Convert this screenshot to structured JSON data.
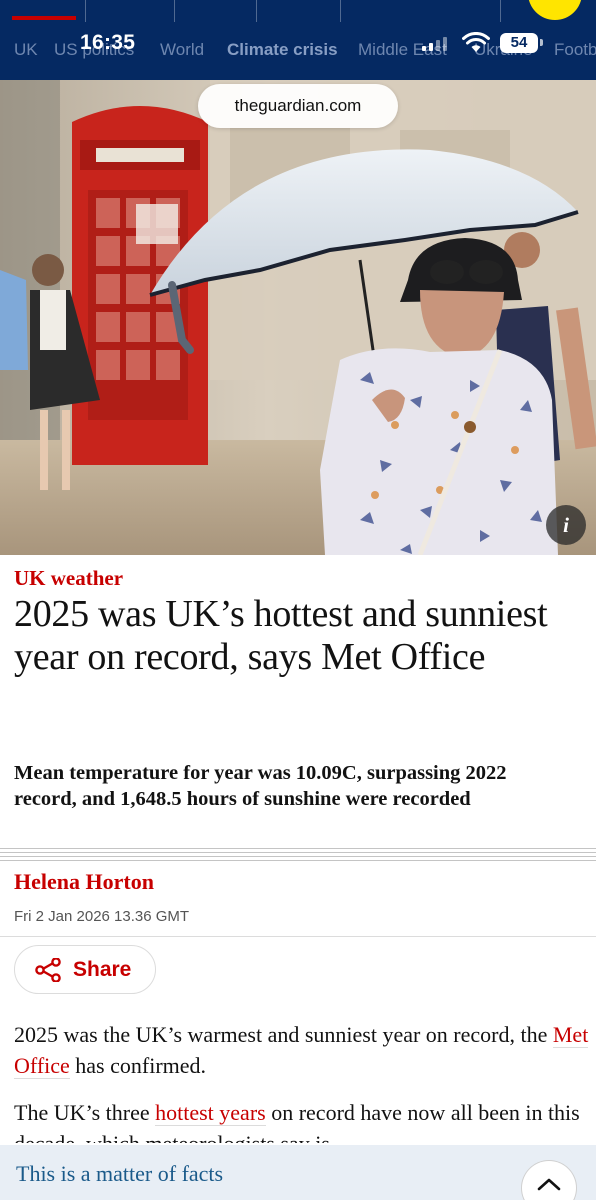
{
  "status_bar": {
    "time": "16:35",
    "battery": "54"
  },
  "nav": {
    "subnav": [
      "UK",
      "US politics",
      "World",
      "Climate crisis",
      "Middle East",
      "Ukraine",
      "Football"
    ],
    "active_subnav": "Climate crisis"
  },
  "browser": {
    "url": "theguardian.com"
  },
  "hero": {
    "info_label": "i"
  },
  "article": {
    "kicker": "UK weather",
    "headline": "2025 was UK’s hottest and sunniest year on record, says Met Office",
    "standfirst": "Mean temperature for year was 10.09C, surpassing 2022 record, and 1,648.5 hours of sunshine were recorded",
    "byline": "Helena Horton",
    "date": "Fri 2 Jan 2026 13.36 GMT",
    "share_label": "Share",
    "p1": {
      "before": "2025 was the UK’s warmest and sunniest year on record, the ",
      "link": "Met Office",
      "after": " has confirmed."
    },
    "p2": {
      "before": "The UK’s three ",
      "link": "hottest years",
      "after": " on record have now all been in this decade, which meteorologists say is"
    }
  },
  "banner": {
    "text": "This is a matter of facts"
  },
  "colors": {
    "brand_navy": "#052962",
    "news_red": "#c70000",
    "support_yellow": "#ffe500"
  }
}
